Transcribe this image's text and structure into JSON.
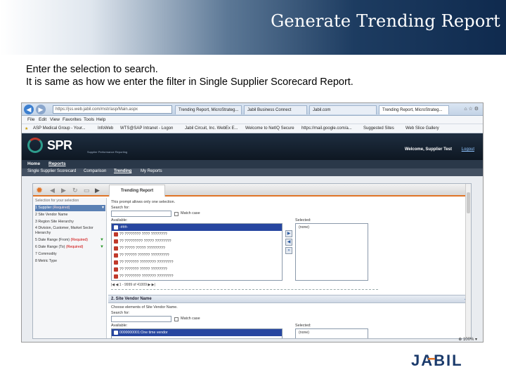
{
  "slide": {
    "title": "Generate Trending Report",
    "intro_line1": "Enter the selection to search.",
    "intro_line2": "It is same as how we enter the filter in Single Supplier Scorecard Report."
  },
  "browser": {
    "address": "https://jss.web.jabil.com/mstr/asp/Main.aspx",
    "tabs": [
      "Trending Report, MicroStrateg...",
      "Jabil Business Connect",
      "Jabil.com",
      "Trending Report, MicroStrateg..."
    ],
    "menu": [
      "File",
      "Edit",
      "View",
      "Favorites",
      "Tools",
      "Help"
    ],
    "favorites": [
      "ASP Medical Group - Your...",
      "InfoWeb",
      "WTS@SAP Intranet - Logon",
      "Jabil Circuit, Inc. WebEx E...",
      "Welcome to NetIQ Secure",
      "https://mail.google.com/a...",
      "Suggested Sites",
      "Web Slice Gallery"
    ],
    "zoom": "100%"
  },
  "app": {
    "logo_text": "SPR",
    "logo_sub": "Supplier Performance Reporting",
    "welcome": "Welcome, Supplier Test",
    "logout": "Logout",
    "nav": [
      "Home",
      "Reports"
    ],
    "subnav": [
      "Single Supplier Scorecard",
      "Comparison",
      "Trending",
      "My Reports"
    ],
    "report_tab": "Trending Report"
  },
  "prompts": [
    {
      "label": "Selection for your selection"
    },
    {
      "label": "1 Supplier",
      "req": "(Required)"
    },
    {
      "label": "2 Site Vendor Name"
    },
    {
      "label": "3 Region  Site Hierarchy"
    },
    {
      "label": "4 Division, Customer, Market Sector Hierarchy"
    },
    {
      "label": "5 Date Range (From)",
      "req": "(Required)"
    },
    {
      "label": "6 Date Range (To)",
      "req": "(Required)"
    },
    {
      "label": "7 Commodity"
    },
    {
      "label": "8 Metric Type"
    }
  ],
  "section1": {
    "intro": "This prompt allows only one selection.",
    "search_for": "Search for:",
    "match_case": "Match case",
    "available": "Available:",
    "selected": "Selected:",
    "selected_value": "(none)",
    "items": [
      "-###-",
      "?? ???????? ???? ????????",
      "?? ????????? ????? ????????",
      "?? ????? ????? ?????????",
      "?? ?????? ?????? ?????????",
      "?? ??????? ???????? ????????",
      "?? ??????? ????? ????????",
      "?? ???????? ??????? ????????"
    ],
    "pager": "1 - 9999 of 41009"
  },
  "section2": {
    "title": "2. Site Vendor Name",
    "intro": "Choose elements of Site Vendor Name.",
    "search_for": "Search for:",
    "match_case": "Match case",
    "available": "Available:",
    "selected": "Selected:",
    "selected_value": "(none)",
    "items": [
      "0000000001:One time vendor"
    ]
  },
  "footer": {
    "logo": "JABIL"
  },
  "colors": {
    "accent": "#e07426",
    "selection": "#2746a0",
    "header_dark": "#0f2a4e"
  }
}
